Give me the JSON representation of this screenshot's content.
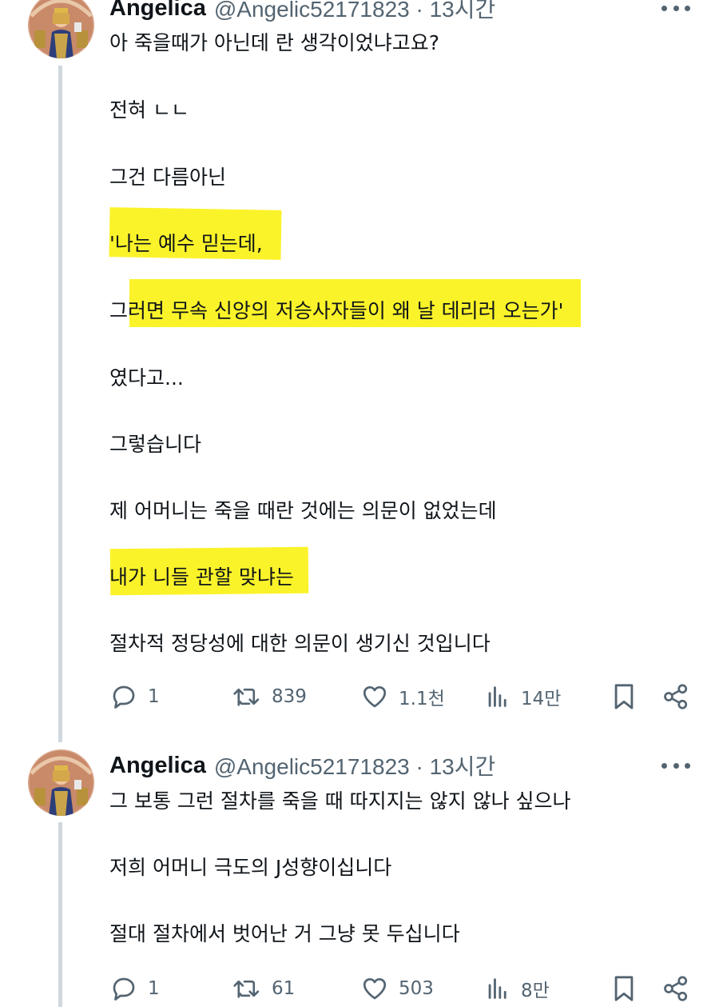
{
  "tweets": [
    {
      "display_name": "Angelica",
      "handle_time": "@Angelic52171823 · 13시간",
      "lines": [
        "아 죽을때가 아닌데 란 생각이었냐고요?",
        "전혀 ㄴㄴ",
        "그건 다름아닌",
        "'나는 예수 믿는데,",
        "그러면 무속 신앙의 저승사자들이 왜 날 데리러 오는가'",
        "였다고...",
        "그렇습니다",
        "제 어머니는 죽을 때란 것에는 의문이 없었는데",
        "내가 니들 관할 맞냐는",
        "절차적 정당성에 대한 의문이 생기신 것입니다"
      ],
      "stats": {
        "replies": "1",
        "reposts": "839",
        "likes": "1.1천",
        "views": "14만"
      }
    },
    {
      "display_name": "Angelica",
      "handle_time": "@Angelic52171823 · 13시간",
      "lines": [
        "그 보통 그런 절차를 죽을 때 따지지는 않지 않나 싶으나",
        "저희 어머니 극도의 J성향이십니다",
        "절대 절차에서 벗어난 거 그냥 못 두십니다"
      ],
      "stats": {
        "replies": "1",
        "reposts": "61",
        "likes": "503",
        "views": "8만"
      }
    }
  ],
  "colors": {
    "highlight": "#fbf32a",
    "secondary_text": "#536471",
    "thread_line": "#cfd9de"
  },
  "icons": [
    "reply-icon",
    "repost-icon",
    "like-icon",
    "views-icon",
    "bookmark-icon",
    "share-icon",
    "more-icon"
  ]
}
